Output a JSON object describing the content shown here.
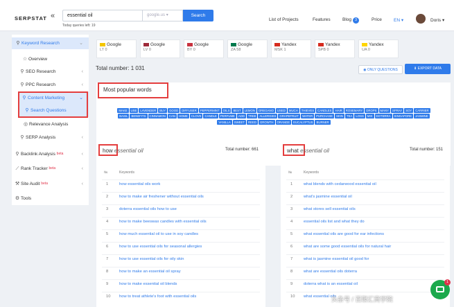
{
  "header": {
    "logo": "SERPSTAT",
    "collapse": "«",
    "search_value": "essential oil",
    "db_select": "google.us",
    "search_button": "Search",
    "queries_left": "Today queries left: 19",
    "nav": {
      "projects": "List of Projects",
      "features": "Features",
      "blog": "Blog",
      "blog_count": "3",
      "price": "Price",
      "lang": "EN ▾",
      "user": "Doris ▾"
    }
  },
  "sidebar": {
    "keyword_research": "Keyword Research",
    "overview": "Overview",
    "seo_research": "SEO Research",
    "ppc_research": "PPC Research",
    "content_marketing": "Content Marketing",
    "search_questions": "Search Questions",
    "relevance_analysis": "Relevance Analysis",
    "serp_analysis": "SERP Analysis",
    "backlink_analysis": "Backlink Analysis",
    "rank_tracker": "Rank Tracker",
    "site_audit": "Site Audit",
    "tools": "Tools",
    "beta": "beta"
  },
  "engines": [
    {
      "name": "Google",
      "code": "LT",
      "count": "0",
      "color": "#f4c600"
    },
    {
      "name": "Google",
      "code": "LV",
      "count": "0",
      "color": "#9e2b3a"
    },
    {
      "name": "Google",
      "code": "BY",
      "count": "0",
      "color": "#c8313e"
    },
    {
      "name": "Google",
      "code": "ZA",
      "count": "58",
      "color": "#007a4d"
    },
    {
      "name": "Yandex",
      "code": "MSK",
      "count": "1",
      "color": "#d52b1e"
    },
    {
      "name": "Yandex",
      "code": "SPB",
      "count": "0",
      "color": "#d52b1e"
    },
    {
      "name": "Yandex",
      "code": "UA",
      "count": "0",
      "color": "#ffd500"
    }
  ],
  "total_number": "Total number: 1 031",
  "only_questions": "ONLY QUESTIONS",
  "export_data": "EXPORT DATA",
  "popular_words_title": "Most popular words",
  "popular_words": [
    "make",
    "use",
    "lavender",
    "buy",
    "good",
    "diffuser",
    "peppermint",
    "oils",
    "best",
    "lemon",
    "oregano",
    "used",
    "much",
    "thieves",
    "candles",
    "hair",
    "rosemary",
    "drops",
    "many",
    "spray",
    "soy",
    "carrier",
    "basil",
    "benefits",
    "cinnamon",
    "can",
    "home",
    "clove",
    "candle",
    "perfume",
    "add",
    "tree",
    "allergies",
    "grapefruit",
    "water",
    "purchase",
    "skin",
    "tea",
    "loss",
    "mix",
    "doterra",
    "singapore",
    "jasmine",
    "vanilla",
    "sweet",
    "reed",
    "growth",
    "orange",
    "eucalyptus",
    "burner"
  ],
  "tables": {
    "how": {
      "title_kw": "how",
      "title_rest": " essential oil",
      "total": "Total number: 661",
      "col_num": "№",
      "col_kw": "Keywords",
      "rows": [
        {
          "n": "1",
          "kw": "how essential oils work"
        },
        {
          "n": "2",
          "kw": "how to make air freshener without essential oils"
        },
        {
          "n": "3",
          "kw": "doterra essential oils how to use"
        },
        {
          "n": "4",
          "kw": "how to make beeswax candles with essential oils"
        },
        {
          "n": "5",
          "kw": "how much essential oil to use in soy candles"
        },
        {
          "n": "6",
          "kw": "how to use essential oils for seasonal allergies"
        },
        {
          "n": "7",
          "kw": "how to use essential oils for oily skin"
        },
        {
          "n": "8",
          "kw": "how to make an essential oil spray"
        },
        {
          "n": "9",
          "kw": "how to make essential oil blends"
        },
        {
          "n": "10",
          "kw": "how to treat athlete's foot with essential oils"
        }
      ]
    },
    "what": {
      "title_kw": "what",
      "title_rest": " essential oil",
      "total": "Total number: 151",
      "col_num": "№",
      "col_kw": "Keywords",
      "rows": [
        {
          "n": "1",
          "kw": "what blends with cedarwood essential oil"
        },
        {
          "n": "2",
          "kw": "what's jasmine essential oil"
        },
        {
          "n": "3",
          "kw": "what stores sell essential oils"
        },
        {
          "n": "4",
          "kw": "essential oils list and what they do"
        },
        {
          "n": "5",
          "kw": "what essential oils are good for ear infections"
        },
        {
          "n": "6",
          "kw": "what are some good essential oils for natural hair"
        },
        {
          "n": "7",
          "kw": "what is jasmine essential oil good for"
        },
        {
          "n": "8",
          "kw": "what are essential oils doterra"
        },
        {
          "n": "9",
          "kw": "doterra what is an essential oil"
        },
        {
          "n": "10",
          "kw": "what essential oils"
        }
      ]
    }
  },
  "chat_badge": "1",
  "watermark": "头条号 / 百聚汇商学院"
}
